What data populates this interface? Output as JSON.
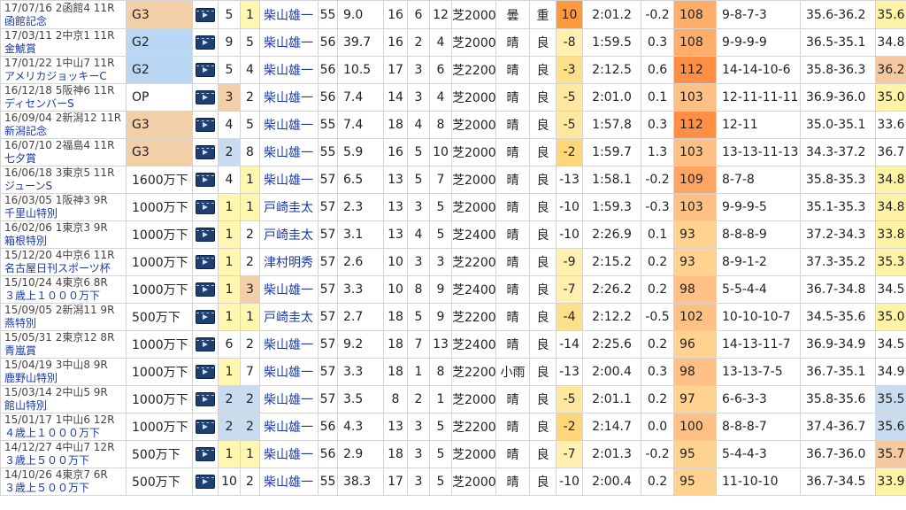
{
  "rows": [
    {
      "date_venue": "17/07/16 2函館4 11R",
      "race_name": "函館記念",
      "grade": "G3",
      "class_bg": "#f3cfa8",
      "waku": "5",
      "waku_bg": "#ffffff",
      "umaban": "1",
      "umaban_bg": "#fff7b0",
      "jockey": "柴山雄一",
      "kinryo": "55",
      "odds": "9.0",
      "tosu": "16",
      "ninki": "6",
      "rank": "12",
      "course": "芝2000",
      "weather": "曇",
      "baba": "重",
      "idx": "10",
      "idx_bg": "#ff9a3c",
      "time": "2:01.2",
      "diff": "-0.2",
      "spd": "108",
      "spd_bg": "#ffad6b",
      "passing": "9-8-7-3",
      "pace": "35.6-36.2",
      "last3f": "35.6",
      "last3f_bg": "#fff3a6"
    },
    {
      "date_venue": "17/03/11 2中京1 11R",
      "race_name": "金鯱賞",
      "grade": "G2",
      "class_bg": "#b9d7f3",
      "waku": "9",
      "waku_bg": "#ffffff",
      "umaban": "5",
      "umaban_bg": "#ffffff",
      "jockey": "柴山雄一",
      "kinryo": "56",
      "odds": "39.7",
      "tosu": "16",
      "ninki": "2",
      "rank": "4",
      "course": "芝2000",
      "weather": "晴",
      "baba": "良",
      "idx": "-8",
      "idx_bg": "#fff0b0",
      "time": "1:59.5",
      "diff": "0.3",
      "spd": "108",
      "spd_bg": "#ffad6b",
      "passing": "9-9-9-9",
      "pace": "36.5-35.1",
      "last3f": "34.8",
      "last3f_bg": "#ffffff"
    },
    {
      "date_venue": "17/01/22 1中山7 11R",
      "race_name": "アメリカジョッキーC",
      "grade": "G2",
      "class_bg": "#b9d7f3",
      "waku": "5",
      "waku_bg": "#ffffff",
      "umaban": "4",
      "umaban_bg": "#ffffff",
      "jockey": "柴山雄一",
      "kinryo": "56",
      "odds": "10.5",
      "tosu": "17",
      "ninki": "3",
      "rank": "6",
      "course": "芝2200",
      "weather": "晴",
      "baba": "良",
      "idx": "-3",
      "idx_bg": "#ffe08a",
      "time": "2:12.5",
      "diff": "0.6",
      "spd": "112",
      "spd_bg": "#ff8f45",
      "passing": "14-14-10-6",
      "pace": "35.8-36.3",
      "last3f": "36.2",
      "last3f_bg": "#f5c8a0"
    },
    {
      "date_venue": "16/12/18 5阪神6 11R",
      "race_name": "ディセンバーS",
      "grade": "OP",
      "class_bg": "#ffffff",
      "waku": "3",
      "waku_bg": "#f3cfa8",
      "umaban": "2",
      "umaban_bg": "#ffffff",
      "jockey": "柴山雄一",
      "kinryo": "56",
      "odds": "7.4",
      "tosu": "14",
      "ninki": "3",
      "rank": "4",
      "course": "芝2000",
      "weather": "晴",
      "baba": "良",
      "idx": "-5",
      "idx_bg": "#ffe7a0",
      "time": "2:01.0",
      "diff": "0.1",
      "spd": "103",
      "spd_bg": "#ffc085",
      "passing": "12-11-11-11",
      "pace": "36.9-36.0",
      "last3f": "35.0",
      "last3f_bg": "#fff3a6"
    },
    {
      "date_venue": "16/09/04 2新潟12 11R",
      "race_name": "新潟記念",
      "grade": "G3",
      "class_bg": "#f3cfa8",
      "waku": "4",
      "waku_bg": "#ffffff",
      "umaban": "5",
      "umaban_bg": "#ffffff",
      "jockey": "柴山雄一",
      "kinryo": "55",
      "odds": "7.4",
      "tosu": "18",
      "ninki": "4",
      "rank": "8",
      "course": "芝2000",
      "weather": "晴",
      "baba": "良",
      "idx": "-5",
      "idx_bg": "#ffe7a0",
      "time": "1:57.8",
      "diff": "0.3",
      "spd": "112",
      "spd_bg": "#ff8f45",
      "passing": "12-11",
      "pace": "35.0-35.1",
      "last3f": "33.6",
      "last3f_bg": "#ffffff"
    },
    {
      "date_venue": "16/07/10 2福島4 11R",
      "race_name": "七夕賞",
      "grade": "G3",
      "class_bg": "#f3cfa8",
      "waku": "2",
      "waku_bg": "#c9dcef",
      "umaban": "8",
      "umaban_bg": "#ffffff",
      "jockey": "柴山雄一",
      "kinryo": "55",
      "odds": "5.9",
      "tosu": "16",
      "ninki": "5",
      "rank": "10",
      "course": "芝2000",
      "weather": "晴",
      "baba": "良",
      "idx": "-2",
      "idx_bg": "#ffd777",
      "time": "1:59.7",
      "diff": "1.3",
      "spd": "103",
      "spd_bg": "#ffc085",
      "passing": "13-13-11-13",
      "pace": "34.3-37.2",
      "last3f": "36.7",
      "last3f_bg": "#ffffff"
    },
    {
      "date_venue": "16/06/18 3東京5 11R",
      "race_name": "ジューンS",
      "grade": "1600万下",
      "class_bg": "#ffffff",
      "waku": "4",
      "waku_bg": "#ffffff",
      "umaban": "1",
      "umaban_bg": "#fff7b0",
      "jockey": "柴山雄一",
      "kinryo": "57",
      "odds": "6.5",
      "tosu": "13",
      "ninki": "5",
      "rank": "7",
      "course": "芝2000",
      "weather": "晴",
      "baba": "良",
      "idx": "-13",
      "idx_bg": "#ffffff",
      "time": "1:58.1",
      "diff": "-0.2",
      "spd": "109",
      "spd_bg": "#ffa564",
      "passing": "8-7-8",
      "pace": "35.8-35.3",
      "last3f": "34.8",
      "last3f_bg": "#fff3a6"
    },
    {
      "date_venue": "16/03/05 1阪神3 9R",
      "race_name": "千里山特別",
      "grade": "1000万下",
      "class_bg": "#ffffff",
      "waku": "1",
      "waku_bg": "#fff7b0",
      "umaban": "1",
      "umaban_bg": "#fff7b0",
      "jockey": "戸崎圭太",
      "kinryo": "57",
      "odds": "2.3",
      "tosu": "13",
      "ninki": "3",
      "rank": "5",
      "course": "芝2000",
      "weather": "晴",
      "baba": "良",
      "idx": "-10",
      "idx_bg": "#ffffff",
      "time": "1:59.3",
      "diff": "-0.3",
      "spd": "103",
      "spd_bg": "#ffc085",
      "passing": "9-9-9-5",
      "pace": "35.1-35.3",
      "last3f": "34.8",
      "last3f_bg": "#fff3a6"
    },
    {
      "date_venue": "16/02/06 1東京3 9R",
      "race_name": "箱根特別",
      "grade": "1000万下",
      "class_bg": "#ffffff",
      "waku": "1",
      "waku_bg": "#fff7b0",
      "umaban": "2",
      "umaban_bg": "#ffffff",
      "jockey": "戸崎圭太",
      "kinryo": "57",
      "odds": "3.1",
      "tosu": "13",
      "ninki": "4",
      "rank": "5",
      "course": "芝2400",
      "weather": "晴",
      "baba": "良",
      "idx": "-10",
      "idx_bg": "#ffffff",
      "time": "2:26.9",
      "diff": "0.1",
      "spd": "93",
      "spd_bg": "#ffd28f",
      "passing": "8-8-8-9",
      "pace": "37.2-34.3",
      "last3f": "33.8",
      "last3f_bg": "#fff3a6"
    },
    {
      "date_venue": "15/12/20 4中京6 11R",
      "race_name": "名古屋日刊スポーツ杯",
      "grade": "1000万下",
      "class_bg": "#ffffff",
      "waku": "1",
      "waku_bg": "#fff7b0",
      "umaban": "2",
      "umaban_bg": "#ffffff",
      "jockey": "津村明秀",
      "kinryo": "57",
      "odds": "2.6",
      "tosu": "10",
      "ninki": "3",
      "rank": "3",
      "course": "芝2200",
      "weather": "晴",
      "baba": "良",
      "idx": "-9",
      "idx_bg": "#fff0b0",
      "time": "2:15.2",
      "diff": "0.2",
      "spd": "93",
      "spd_bg": "#ffd28f",
      "passing": "8-9-1-2",
      "pace": "37.3-35.2",
      "last3f": "35.3",
      "last3f_bg": "#fff3a6"
    },
    {
      "date_venue": "15/10/24 4東京6 8R",
      "race_name": "３歳上１０００万下",
      "grade": "1000万下",
      "class_bg": "#ffffff",
      "waku": "1",
      "waku_bg": "#fff7b0",
      "umaban": "3",
      "umaban_bg": "#f3cfa8",
      "jockey": "柴山雄一",
      "kinryo": "57",
      "odds": "3.3",
      "tosu": "10",
      "ninki": "8",
      "rank": "9",
      "course": "芝2400",
      "weather": "晴",
      "baba": "良",
      "idx": "-7",
      "idx_bg": "#fff0b0",
      "time": "2:26.2",
      "diff": "0.2",
      "spd": "98",
      "spd_bg": "#ffc085",
      "passing": "5-5-4-4",
      "pace": "36.7-34.8",
      "last3f": "34.5",
      "last3f_bg": "#ffffff"
    },
    {
      "date_venue": "15/09/05 2新潟11 9R",
      "race_name": "燕特別",
      "grade": "500万下",
      "class_bg": "#ffffff",
      "waku": "1",
      "waku_bg": "#fff7b0",
      "umaban": "1",
      "umaban_bg": "#fff7b0",
      "jockey": "戸崎圭太",
      "kinryo": "57",
      "odds": "2.7",
      "tosu": "18",
      "ninki": "5",
      "rank": "9",
      "course": "芝2200",
      "weather": "晴",
      "baba": "良",
      "idx": "-4",
      "idx_bg": "#ffe08a",
      "time": "2:12.2",
      "diff": "-0.5",
      "spd": "102",
      "spd_bg": "#ffc085",
      "passing": "10-10-10-7",
      "pace": "34.5-35.6",
      "last3f": "35.0",
      "last3f_bg": "#fff3a6"
    },
    {
      "date_venue": "15/05/31 2東京12 8R",
      "race_name": "青嵐賞",
      "grade": "1000万下",
      "class_bg": "#ffffff",
      "waku": "6",
      "waku_bg": "#ffffff",
      "umaban": "2",
      "umaban_bg": "#ffffff",
      "jockey": "柴山雄一",
      "kinryo": "57",
      "odds": "9.2",
      "tosu": "18",
      "ninki": "7",
      "rank": "13",
      "course": "芝2400",
      "weather": "晴",
      "baba": "良",
      "idx": "-14",
      "idx_bg": "#ffffff",
      "time": "2:25.6",
      "diff": "0.2",
      "spd": "96",
      "spd_bg": "#ffd28f",
      "passing": "14-13-11-7",
      "pace": "36.9-34.9",
      "last3f": "34.5",
      "last3f_bg": "#ffffff"
    },
    {
      "date_venue": "15/04/19 3中山8 9R",
      "race_name": "鹿野山特別",
      "grade": "1000万下",
      "class_bg": "#ffffff",
      "waku": "1",
      "waku_bg": "#fff7b0",
      "umaban": "7",
      "umaban_bg": "#ffffff",
      "jockey": "柴山雄一",
      "kinryo": "57",
      "odds": "3.3",
      "tosu": "18",
      "ninki": "1",
      "rank": "8",
      "course": "芝2200",
      "weather": "小雨",
      "baba": "良",
      "idx": "-13",
      "idx_bg": "#ffffff",
      "time": "2:00.4",
      "diff": "0.3",
      "spd": "98",
      "spd_bg": "#ffc085",
      "passing": "13-13-7-5",
      "pace": "36.7-35.1",
      "last3f": "34.9",
      "last3f_bg": "#ffffff"
    },
    {
      "date_venue": "15/03/14 2中山5 9R",
      "race_name": "館山特別",
      "grade": "1000万下",
      "class_bg": "#ffffff",
      "waku": "2",
      "waku_bg": "#c9dcef",
      "umaban": "2",
      "umaban_bg": "#c9dcef",
      "jockey": "柴山雄一",
      "kinryo": "57",
      "odds": "3.5",
      "tosu": "8",
      "ninki": "2",
      "rank": "1",
      "course": "芝2000",
      "weather": "晴",
      "baba": "良",
      "idx": "-5",
      "idx_bg": "#ffe7a0",
      "time": "2:01.1",
      "diff": "0.2",
      "spd": "97",
      "spd_bg": "#ffd28f",
      "passing": "6-6-3-3",
      "pace": "35.8-35.6",
      "last3f": "35.5",
      "last3f_bg": "#c9dcef"
    },
    {
      "date_venue": "15/01/17 1中山6 12R",
      "race_name": "４歳上１０００万下",
      "grade": "1000万下",
      "class_bg": "#ffffff",
      "waku": "2",
      "waku_bg": "#c9dcef",
      "umaban": "2",
      "umaban_bg": "#c9dcef",
      "jockey": "柴山雄一",
      "kinryo": "56",
      "odds": "4.3",
      "tosu": "13",
      "ninki": "3",
      "rank": "5",
      "course": "芝2200",
      "weather": "晴",
      "baba": "良",
      "idx": "-2",
      "idx_bg": "#ffd777",
      "time": "2:14.7",
      "diff": "0.0",
      "spd": "100",
      "spd_bg": "#ffc085",
      "passing": "8-8-8-7",
      "pace": "37.4-36.7",
      "last3f": "35.6",
      "last3f_bg": "#c9dcef"
    },
    {
      "date_venue": "14/12/27 4中山7 12R",
      "race_name": "３歳上５００万下",
      "grade": "500万下",
      "class_bg": "#ffffff",
      "waku": "1",
      "waku_bg": "#fff7b0",
      "umaban": "1",
      "umaban_bg": "#fff7b0",
      "jockey": "柴山雄一",
      "kinryo": "56",
      "odds": "2.9",
      "tosu": "18",
      "ninki": "3",
      "rank": "5",
      "course": "芝2000",
      "weather": "晴",
      "baba": "良",
      "idx": "-7",
      "idx_bg": "#fff0b0",
      "time": "2:01.3",
      "diff": "-0.2",
      "spd": "95",
      "spd_bg": "#ffd28f",
      "passing": "5-4-4-3",
      "pace": "36.7-36.0",
      "last3f": "35.7",
      "last3f_bg": "#f5c8a0"
    },
    {
      "date_venue": "14/10/26 4東京7 6R",
      "race_name": "３歳上５００万下",
      "grade": "500万下",
      "class_bg": "#ffffff",
      "waku": "10",
      "waku_bg": "#ffffff",
      "umaban": "2",
      "umaban_bg": "#ffffff",
      "jockey": "柴山雄一",
      "kinryo": "55",
      "odds": "38.3",
      "tosu": "17",
      "ninki": "3",
      "rank": "5",
      "course": "芝2000",
      "weather": "晴",
      "baba": "良",
      "idx": "-10",
      "idx_bg": "#ffffff",
      "time": "2:00.4",
      "diff": "0.2",
      "spd": "95",
      "spd_bg": "#ffd28f",
      "passing": "11-10-10",
      "pace": "36.7-34.5",
      "last3f": "33.9",
      "last3f_bg": "#fff3a6"
    }
  ]
}
